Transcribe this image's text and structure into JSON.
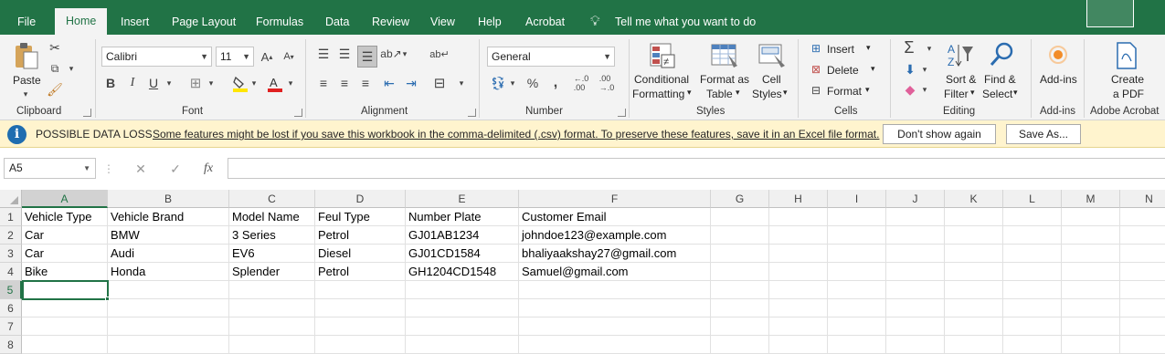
{
  "tabs": [
    "File",
    "Home",
    "Insert",
    "Page Layout",
    "Formulas",
    "Data",
    "Review",
    "View",
    "Help",
    "Acrobat"
  ],
  "active_tab": "Home",
  "tell_me": "Tell me what you want to do",
  "clipboard": {
    "paste": "Paste",
    "group": "Clipboard"
  },
  "font": {
    "name": "Calibri",
    "size": "11",
    "group": "Font"
  },
  "alignment": {
    "group": "Alignment"
  },
  "number": {
    "format": "General",
    "group": "Number",
    "percent": "%"
  },
  "styles": {
    "conditional_1": "Conditional",
    "conditional_2": "Formatting",
    "format_as_1": "Format as",
    "format_as_2": "Table",
    "cell_styles_1": "Cell",
    "cell_styles_2": "Styles",
    "group": "Styles"
  },
  "cells": {
    "insert": "Insert",
    "delete": "Delete",
    "format": "Format",
    "group": "Cells"
  },
  "editing": {
    "sort_1": "Sort &",
    "sort_2": "Filter",
    "find_1": "Find &",
    "find_2": "Select",
    "group": "Editing"
  },
  "addins": {
    "label": "Add-ins",
    "group": "Add-ins"
  },
  "acrobat": {
    "create_1": "Create",
    "create_2": "a PDF",
    "group": "Adobe Acrobat"
  },
  "message_bar": {
    "title": "POSSIBLE DATA LOSS",
    "text": "Some features might be lost if you save this workbook in the comma-delimited (.csv) format. To preserve these features, save it in an Excel file format.",
    "dont_show": "Don't show again",
    "save_as": "Save As..."
  },
  "formula_bar": {
    "name_box": "A5",
    "fx": "fx",
    "value": ""
  },
  "columns": [
    "A",
    "B",
    "C",
    "D",
    "E",
    "F",
    "G",
    "H",
    "I",
    "J",
    "K",
    "L",
    "M",
    "N"
  ],
  "rows": [
    "1",
    "2",
    "3",
    "4",
    "5",
    "6",
    "7",
    "8"
  ],
  "active_cell": "A5",
  "sheet": [
    [
      "Vehicle Type",
      "Vehicle Brand",
      "Model Name",
      "Feul Type",
      "Number Plate",
      "Customer Email"
    ],
    [
      "Car",
      "BMW",
      "3 Series",
      "Petrol",
      "GJ01AB1234",
      "johndoe123@example.com"
    ],
    [
      "Car",
      "Audi",
      "EV6",
      "Diesel",
      "GJ01CD1584",
      "bhaliyaakshay27@gmail.com"
    ],
    [
      "Bike",
      "Honda",
      "Splender",
      "Petrol",
      "GH1204CD1548",
      "Samuel@gmail.com"
    ]
  ],
  "colors": {
    "brand": "#217346",
    "message_bar": "#fff4ce",
    "info": "#1f6db0"
  }
}
